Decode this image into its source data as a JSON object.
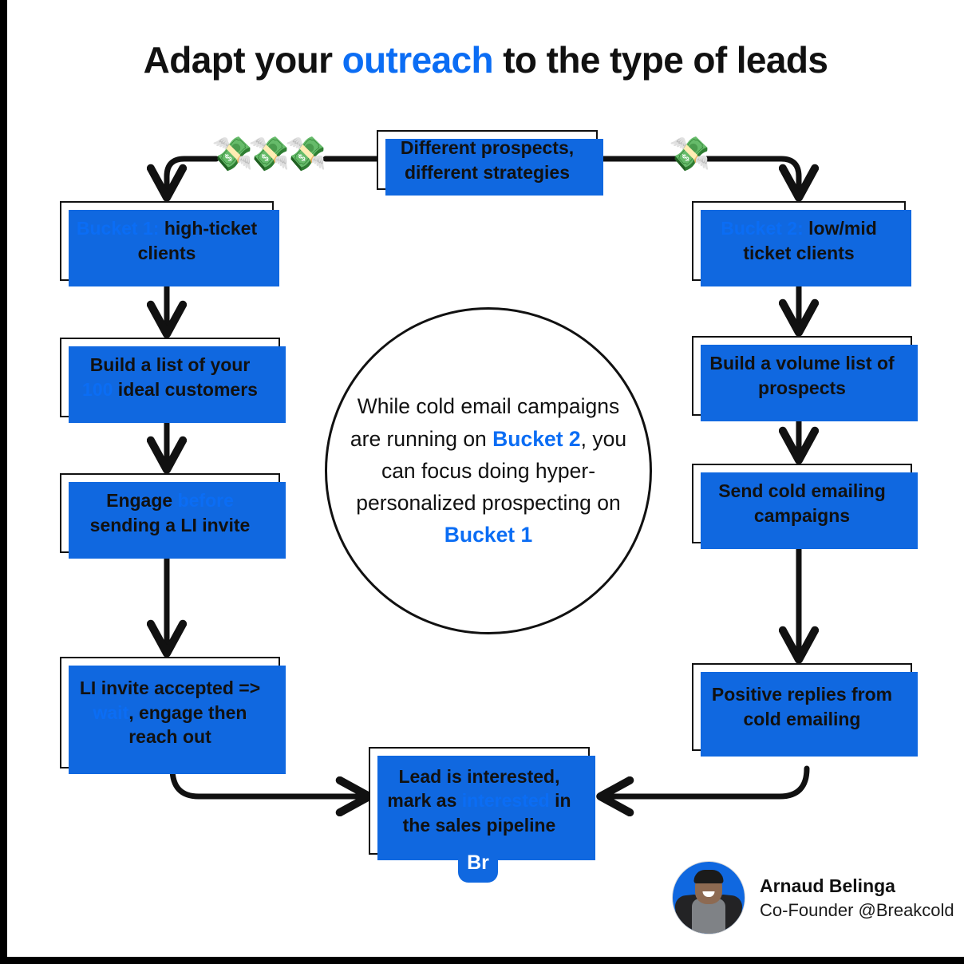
{
  "page": {
    "title_prefix": "Adapt your ",
    "title_highlight": "outreach",
    "title_suffix": " to the type of leads",
    "accent_blue": "#0B6DF4",
    "shadow_blue": "#1068E0",
    "ink": "#111111",
    "background": "#ffffff"
  },
  "decorations": {
    "money_left": "💸",
    "money_mid": "💸",
    "money_right": "💸",
    "money_far_right": "💸"
  },
  "nodes": {
    "source": {
      "line1": "Different prospects,",
      "line2": "different strategies"
    },
    "bucket1": {
      "label": "Bucket 1:",
      "rest": " high-ticket",
      "line2": "clients"
    },
    "bucket2": {
      "label": "Bucket 2:",
      "rest": " low/mid",
      "line2": "ticket clients"
    },
    "left_build": {
      "line1": "Build a list of your",
      "count": "100",
      "line2_rest": " ideal customers"
    },
    "left_engage": {
      "pre": "Engage ",
      "hl": "before",
      "line2": "sending a LI invite"
    },
    "left_invite": {
      "line1": "LI invite accepted =>",
      "hl": "wait",
      "line2_rest": ", engage then",
      "line3": "reach out"
    },
    "right_build": {
      "line1": "Build a volume list of",
      "line2": "prospects"
    },
    "right_send": {
      "line1": "Send cold emailing",
      "line2": "campaigns"
    },
    "right_replies": {
      "line1": "Positive replies from",
      "line2": "cold emailing"
    },
    "outcome": {
      "line1": "Lead is interested,",
      "line2_pre": "mark as ",
      "line2_hl": "interested",
      "line2_post": " in",
      "line3": "the sales pipeline"
    }
  },
  "circle": {
    "part1": "While cold email campaigns are running  on ",
    "bucket2": "Bucket 2",
    "part2": ", you can focus doing hyper-personalized prospecting on ",
    "bucket1": "Bucket 1"
  },
  "brand": {
    "badge": "Br"
  },
  "signature": {
    "name": "Arnaud Belinga",
    "role": "Co-Founder @Breakcold"
  }
}
